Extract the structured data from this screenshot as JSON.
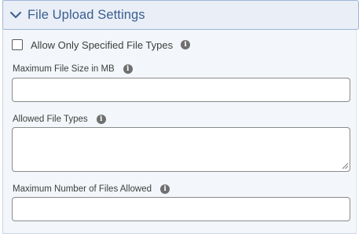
{
  "section": {
    "title": "File Upload Settings",
    "expanded": true,
    "toggle_icon": "chevron-down-icon",
    "accent_color": "#3a5e8f"
  },
  "allow_specified_types": {
    "label": "Allow Only Specified File Types",
    "checked": false,
    "info_icon": "info-icon"
  },
  "max_file_size": {
    "label": "Maximum File Size in MB",
    "value": "",
    "info_icon": "info-icon"
  },
  "allowed_file_types": {
    "label": "Allowed File Types",
    "value": "",
    "info_icon": "info-icon"
  },
  "max_files": {
    "label": "Maximum Number of Files Allowed",
    "value": "",
    "info_icon": "info-icon"
  },
  "info_glyph": "i"
}
